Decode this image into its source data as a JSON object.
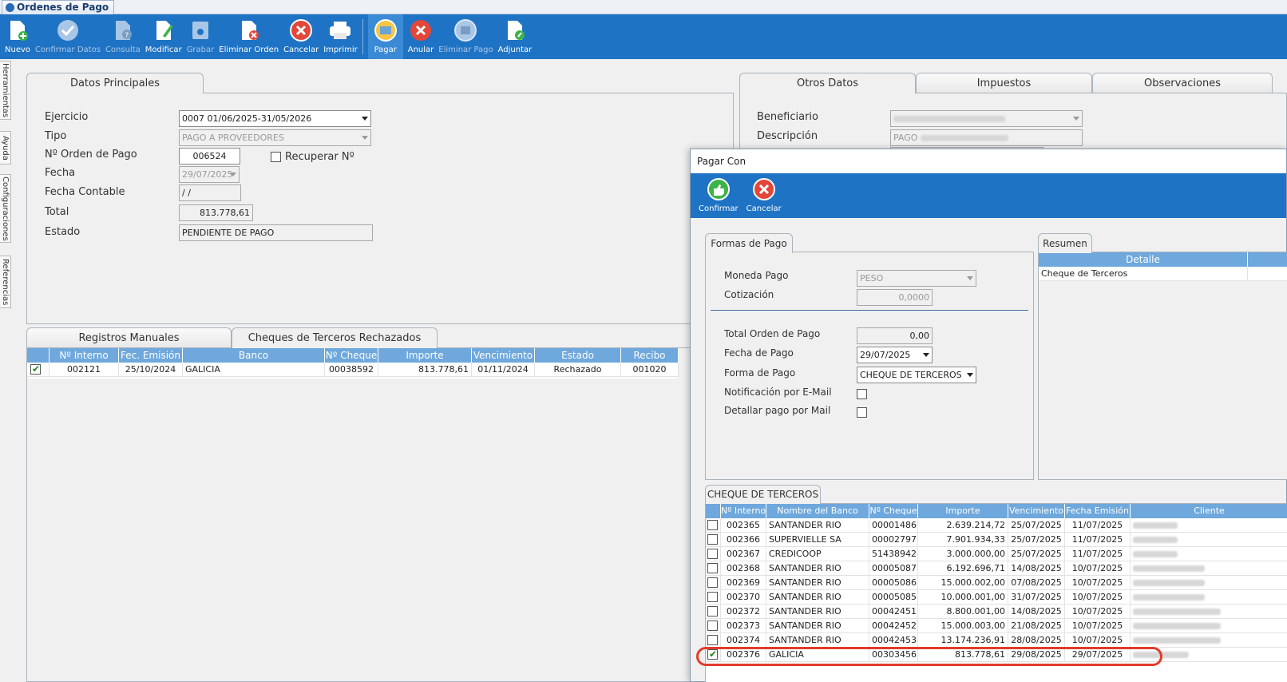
{
  "window": {
    "tab_title": "Ordenes de Pago"
  },
  "toolbar": [
    {
      "label": "Nuevo",
      "icon": "new-doc-icon",
      "enabled": true
    },
    {
      "label": "Confirmar Datos",
      "icon": "check-icon",
      "enabled": false
    },
    {
      "label": "Consulta",
      "icon": "query-icon",
      "enabled": false
    },
    {
      "label": "Modificar",
      "icon": "edit-icon",
      "enabled": true
    },
    {
      "label": "Grabar",
      "icon": "save-icon",
      "enabled": false
    },
    {
      "label": "Eliminar Orden",
      "icon": "delete-doc-icon",
      "enabled": true
    },
    {
      "label": "Cancelar",
      "icon": "cancel-icon",
      "enabled": true
    },
    {
      "label": "Imprimir",
      "icon": "printer-icon",
      "enabled": true
    },
    {
      "label": "Pagar",
      "icon": "pay-icon",
      "enabled": true
    },
    {
      "label": "Anular",
      "icon": "void-icon",
      "enabled": true
    },
    {
      "label": "Eliminar Pago",
      "icon": "delete-payment-icon",
      "enabled": false
    },
    {
      "label": "Adjuntar",
      "icon": "attach-icon",
      "enabled": true
    }
  ],
  "side_tabs": [
    "Herramientas",
    "Ayuda",
    "Configuraciones",
    "Referencias"
  ],
  "main_tabs": {
    "datos_principales": "Datos Principales"
  },
  "form": {
    "ejercicio_label": "Ejercicio",
    "ejercicio_value": "0007 01/06/2025-31/05/2026",
    "tipo_label": "Tipo",
    "tipo_value": "PAGO A PROVEEDORES",
    "orden_label": "Nº Orden de Pago",
    "orden_value": "006524",
    "recuperar_label": "Recuperar Nº",
    "fecha_label": "Fecha",
    "fecha_value": "29/07/2025",
    "fecha_contable_label": "Fecha Contable",
    "fecha_contable_value": " /  /",
    "total_label": "Total",
    "total_value": "813.778,61",
    "estado_label": "Estado",
    "estado_value": "PENDIENTE DE PAGO"
  },
  "right_tabs": [
    "Otros Datos",
    "Impuestos",
    "Observaciones"
  ],
  "otros": {
    "beneficiario_label": "Beneficiario",
    "descripcion_label": "Descripción",
    "descripcion_value": "PAGO"
  },
  "lower_tabs": [
    "Registros Manuales",
    "Cheques de Terceros Rechazados"
  ],
  "rejected_grid": {
    "headers": [
      "Nº Interno",
      "Fec. Emisión",
      "Banco",
      "Nº Cheque",
      "Importe",
      "Vencimiento",
      "Estado",
      "Recibo"
    ],
    "rows": [
      {
        "checked": true,
        "interno": "002121",
        "emision": "25/10/2024",
        "banco": "GALICIA",
        "cheque": "00038592",
        "importe": "813.778,61",
        "vencimiento": "01/11/2024",
        "estado": "Rechazado",
        "recibo": "001020"
      }
    ]
  },
  "dialog": {
    "title": "Pagar Con",
    "toolbar": [
      {
        "label": "Confirmar",
        "icon": "confirm-thumb-icon"
      },
      {
        "label": "Cancelar",
        "icon": "cancel-icon"
      }
    ],
    "formas_tab": "Formas de Pago",
    "resumen_tab": "Resumen",
    "moneda_label": "Moneda Pago",
    "moneda_value": "PESO",
    "cotizacion_label": "Cotización",
    "cotizacion_value": "0,0000",
    "total_label": "Total Orden de Pago",
    "total_value": "0,00",
    "fecha_pago_label": "Fecha de Pago",
    "fecha_pago_value": "29/07/2025",
    "forma_label": "Forma de Pago",
    "forma_value": "CHEQUE DE TERCEROS",
    "notif_label": "Notificación por E-Mail",
    "detallar_label": "Detallar pago por Mail",
    "resumen_header": "Detalle",
    "resumen_rows": [
      "Cheque de Terceros"
    ],
    "cheques_tab": "CHEQUE DE TERCEROS",
    "cheques_headers": [
      "Nº Interno",
      "Nombre del Banco",
      "Nº Cheque",
      "Importe",
      "Vencimiento",
      "Fecha Emisión",
      "Cliente"
    ],
    "cheques_rows": [
      {
        "checked": false,
        "interno": "002365",
        "banco": "SANTANDER RIO",
        "cheque": "00001486",
        "importe": "2.639.214,72",
        "venc": "25/07/2025",
        "emision": "11/07/2025"
      },
      {
        "checked": false,
        "interno": "002366",
        "banco": "SUPERVIELLE SA",
        "cheque": "00002797",
        "importe": "7.901.934,33",
        "venc": "25/07/2025",
        "emision": "11/07/2025"
      },
      {
        "checked": false,
        "interno": "002367",
        "banco": "CREDICOOP",
        "cheque": "51438942",
        "importe": "3.000.000,00",
        "venc": "25/07/2025",
        "emision": "11/07/2025"
      },
      {
        "checked": false,
        "interno": "002368",
        "banco": "SANTANDER RIO",
        "cheque": "00005087",
        "importe": "6.192.696,71",
        "venc": "14/08/2025",
        "emision": "10/07/2025"
      },
      {
        "checked": false,
        "interno": "002369",
        "banco": "SANTANDER RIO",
        "cheque": "00005086",
        "importe": "15.000.002,00",
        "venc": "07/08/2025",
        "emision": "10/07/2025"
      },
      {
        "checked": false,
        "interno": "002370",
        "banco": "SANTANDER RIO",
        "cheque": "00005085",
        "importe": "10.000.001,00",
        "venc": "31/07/2025",
        "emision": "10/07/2025"
      },
      {
        "checked": false,
        "interno": "002372",
        "banco": "SANTANDER RIO",
        "cheque": "00042451",
        "importe": "8.800.001,00",
        "venc": "14/08/2025",
        "emision": "10/07/2025"
      },
      {
        "checked": false,
        "interno": "002373",
        "banco": "SANTANDER RIO",
        "cheque": "00042452",
        "importe": "15.000.003,00",
        "venc": "21/08/2025",
        "emision": "10/07/2025"
      },
      {
        "checked": false,
        "interno": "002374",
        "banco": "SANTANDER RIO",
        "cheque": "00042453",
        "importe": "13.174.236,91",
        "venc": "28/08/2025",
        "emision": "10/07/2025"
      },
      {
        "checked": true,
        "interno": "002376",
        "banco": "GALICIA",
        "cheque": "00303456",
        "importe": "813.778,61",
        "venc": "29/08/2025",
        "emision": "29/07/2025"
      }
    ]
  },
  "colors": {
    "toolbar_bg": "#1f73c4",
    "grid_header": "#6fa8dc",
    "highlight": "#e23b2b"
  }
}
